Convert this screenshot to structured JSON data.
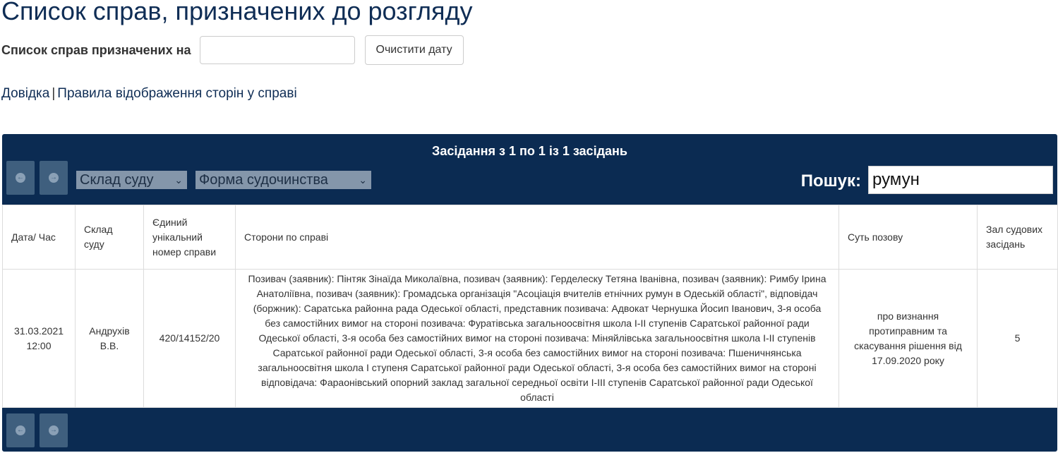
{
  "page": {
    "title": "Список справ, призначених до розгляду",
    "date_label": "Список справ призначених на",
    "date_value": "",
    "clear_button": "Очистити дату",
    "links": {
      "help": "Довідка",
      "separator": "|",
      "rules": "Правила відображення сторін у справі"
    }
  },
  "toolbar": {
    "sessions_info": "Засідання з 1 по 1 із 1 засідань",
    "court_composition_select": "Склад суду",
    "proceeding_form_select": "Форма судочинства",
    "search_label": "Пошук:",
    "search_value": "румун"
  },
  "table": {
    "headers": [
      "Дата/ Час",
      "Склад суду",
      "Єдиний унікальний номер справи",
      "Сторони по справі",
      "Суть позову",
      "Зал судових засідань"
    ],
    "rows": [
      {
        "date": "31.03.2021",
        "time": "12:00",
        "judge": "Андрухів В.В.",
        "case_number": "420/14152/20",
        "parties": "Позивач (заявник): Пінтяк Зінаїда Миколаївна, позивач (заявник): Герделеску Тетяна Іванівна, позивач (заявник): Римбу Ірина Анатоліївна, позивач (заявник): Громадська організація \"Асоціація вчителів етнічних румун в Одеській області\", відповідач (боржник): Саратська районна рада Одеської області, представник позивача: Адвокат Чернушка Йосип Іванович, 3-я особа без самостійних вимог на стороні позивача: Фуратівська загальноосвітня школа І-ІІ ступенів Саратської районної ради Одеської області, 3-я особа без самостійних вимог на стороні позивача: Міняйлівська загальноосвітня школа І-ІІ ступенів Саратської районної ради Одеської області, 3-я особа без самостійних вимог на стороні позивача: Пшеничнянська загальноосвітня школа І ступеня Саратської районної ради Одеської області, 3-я особа без самостійних вимог на стороні відповідача: Фараонівський опорний заклад загальної середньої освіти І-ІІІ ступенів Саратської районної ради Одеської області",
        "claim": "про визнання протиправним та скасування рішення від 17.09.2020 року",
        "hall": "5"
      }
    ]
  },
  "colors": {
    "panel_bg": "#0b2b52",
    "title": "#0f2d55",
    "nav_button": "#3f5f7e"
  },
  "icons": {
    "prev": "arrow-left-circle-icon",
    "next": "arrow-right-circle-icon",
    "dropdown": "chevron-down-icon"
  }
}
